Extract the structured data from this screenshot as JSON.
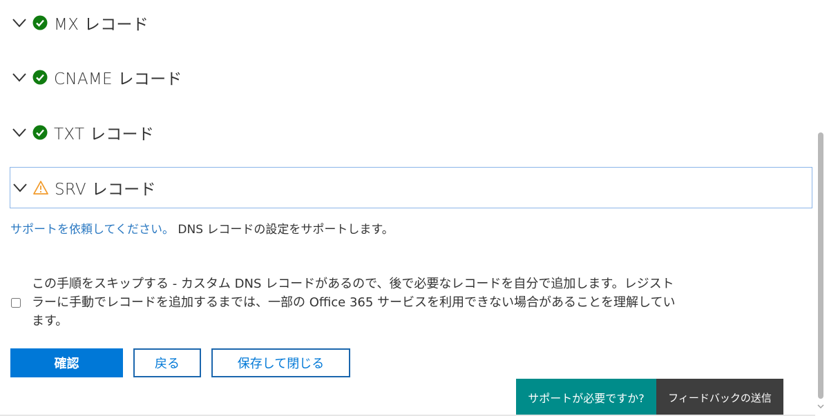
{
  "records": [
    {
      "label": "MX レコード",
      "status": "success",
      "icon": "check-circle-icon"
    },
    {
      "label": "CNAME レコード",
      "status": "success",
      "icon": "check-circle-icon"
    },
    {
      "label": "TXT レコード",
      "status": "success",
      "icon": "check-circle-icon"
    },
    {
      "label": "SRV レコード",
      "status": "warning",
      "icon": "warning-triangle-icon"
    }
  ],
  "help": {
    "link_text": "サポートを依頼してください。",
    "text": " DNS レコードの設定をサポートします。"
  },
  "skip": {
    "checked": false,
    "text": "この手順をスキップする - カスタム DNS レコードがあるので、後で必要なレコードを自分で追加します。レジストラーに手動でレコードを追加するまでは、一部の Office 365 サービスを利用できない場合があることを理解しています。"
  },
  "buttons": {
    "confirm": "確認",
    "back": "戻る",
    "save_close": "保存して閉じる"
  },
  "bottom_bar": {
    "support": "サポートが必要ですか?",
    "feedback": "フィードバックの送信"
  },
  "colors": {
    "success": "#107c10",
    "warning": "#f29b2b",
    "primary": "#0078d7",
    "link": "#2b79c2",
    "support_bg": "#008c8a",
    "feedback_bg": "#3e3e3e"
  }
}
